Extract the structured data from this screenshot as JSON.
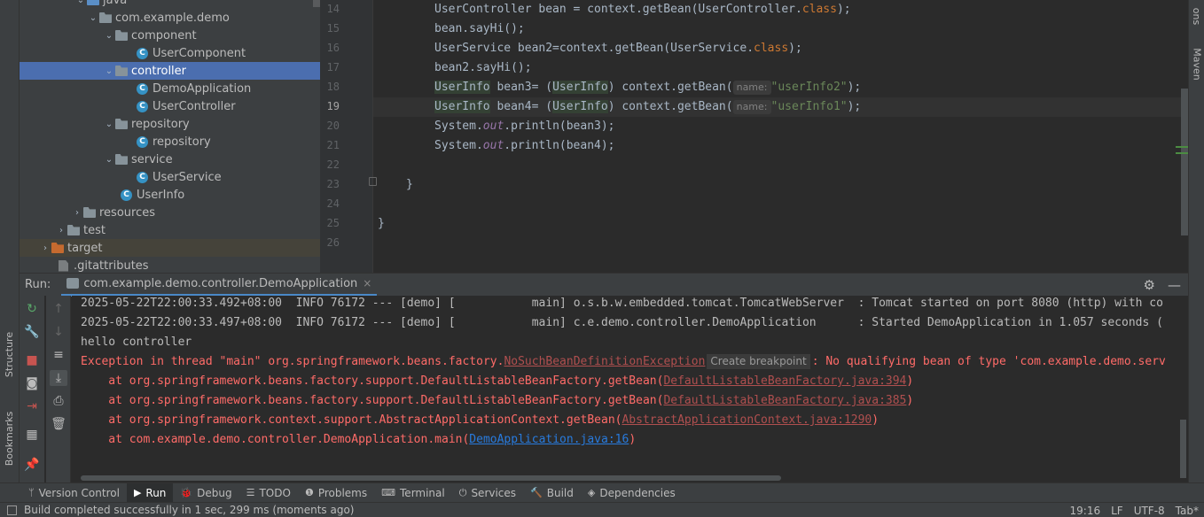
{
  "left_strip": {
    "structure": "Structure",
    "bookmarks": "Bookmarks"
  },
  "right_strip": {
    "notifications": "ons",
    "maven": "Maven"
  },
  "project_tree": [
    {
      "label": "java",
      "kind": "folder-blue",
      "expanded": true
    },
    {
      "label": "com.example.demo",
      "kind": "package",
      "expanded": true
    },
    {
      "label": "component",
      "kind": "package",
      "expanded": true
    },
    {
      "label": "UserComponent",
      "kind": "class"
    },
    {
      "label": "controller",
      "kind": "package",
      "expanded": true,
      "selected": true
    },
    {
      "label": "DemoApplication",
      "kind": "class"
    },
    {
      "label": "UserController",
      "kind": "class"
    },
    {
      "label": "repository",
      "kind": "package",
      "expanded": true
    },
    {
      "label": "repository",
      "kind": "class"
    },
    {
      "label": "service",
      "kind": "package",
      "expanded": true
    },
    {
      "label": "UserService",
      "kind": "class"
    },
    {
      "label": "UserInfo",
      "kind": "class"
    },
    {
      "label": "resources",
      "kind": "folder",
      "expanded": false
    },
    {
      "label": "test",
      "kind": "folder",
      "expanded": false
    },
    {
      "label": "target",
      "kind": "folder-orange",
      "expanded": false
    },
    {
      "label": ".gitattributes",
      "kind": "file"
    }
  ],
  "editor": {
    "line_numbers": [
      "14",
      "15",
      "16",
      "17",
      "18",
      "19",
      "20",
      "21",
      "22",
      "23",
      "24",
      "25",
      "26"
    ],
    "current_line": "19",
    "code": {
      "l14a": "UserController bean = context.getBean(UserController.",
      "l14kw": "class",
      "l14b": ");",
      "l15": "bean.sayHi();",
      "l16a": "UserService bean2=context.getBean(UserService.",
      "l16kw": "class",
      "l16b": ");",
      "l17": "bean2.sayHi();",
      "l18type": "UserInfo",
      "l18a": " bean3= (",
      "l18b": ") context.getBean(",
      "l18hint": "name:",
      "l18str": "\"userInfo2\"",
      "l18c": ");",
      "l19type": "UserInfo",
      "l19a": " bean4= (",
      "l19b": ") context.getBean(",
      "l19hint": "name:",
      "l19str": "\"userInfo1\"",
      "l19c": ");",
      "l20a": "System.",
      "l20fld": "out",
      "l20b": ".println(bean3);",
      "l21a": "System.",
      "l21fld": "out",
      "l21b": ".println(bean4);",
      "l24": "}",
      "l26": "}"
    }
  },
  "run": {
    "label": "Run:",
    "tab": "com.example.demo.controller.DemoApplication",
    "close": "×",
    "settings_icon": "⚙",
    "minimize_icon": "—"
  },
  "console": {
    "log1": "2025-05-22T22:00:33.492+08:00  INFO 76172 --- [demo] [           main] o.s.b.w.embedded.tomcat.TomcatWebServer  : Tomcat started on port 8080 (http) with co",
    "log2": "2025-05-22T22:00:33.497+08:00  INFO 76172 --- [demo] [           main] c.e.demo.controller.DemoApplication      : Started DemoApplication in 1.057 seconds (",
    "hello": "hello controller",
    "exc_a": "Exception in thread \"main\" org.springframework.beans.factory.",
    "exc_class": "NoSuchBeanDefinitionException",
    "exc_bp": "Create breakpoint",
    "exc_b": ": No qualifying bean of type 'com.example.demo.serv",
    "st1a": "    at org.springframework.beans.factory.support.DefaultListableBeanFactory.getBean(",
    "st1link": "DefaultListableBeanFactory.java:394",
    "st1b": ")",
    "st2a": "    at org.springframework.beans.factory.support.DefaultListableBeanFactory.getBean(",
    "st2link": "DefaultListableBeanFactory.java:385",
    "st2b": ")",
    "st3a": "    at org.springframework.context.support.AbstractApplicationContext.getBean(",
    "st3link": "AbstractApplicationContext.java:1290",
    "st3b": ")",
    "st4a": "    at com.example.demo.controller.DemoApplication.main(",
    "st4link": "DemoApplication.java:16",
    "st4b": ")"
  },
  "bottom_tabs": [
    {
      "icon": "ᛘ",
      "label": "Version Control"
    },
    {
      "icon": "▶",
      "label": "Run",
      "active": true
    },
    {
      "icon": "🐞",
      "label": "Debug"
    },
    {
      "icon": "☰",
      "label": "TODO"
    },
    {
      "icon": "❶",
      "label": "Problems"
    },
    {
      "icon": "⌨",
      "label": "Terminal"
    },
    {
      "icon": "⏻",
      "label": "Services"
    },
    {
      "icon": "🔨",
      "label": "Build"
    },
    {
      "icon": "◈",
      "label": "Dependencies"
    }
  ],
  "status": {
    "message": "Build completed successfully in 1 sec, 299 ms (moments ago)",
    "position": "19:16",
    "line_sep": "LF",
    "encoding": "UTF-8",
    "indent": "Tab*"
  },
  "colors": {
    "selection": "#4b6eaf",
    "error": "#ff6b68",
    "link": "#287bde",
    "keyword": "#cc7832",
    "string": "#6a8759"
  }
}
